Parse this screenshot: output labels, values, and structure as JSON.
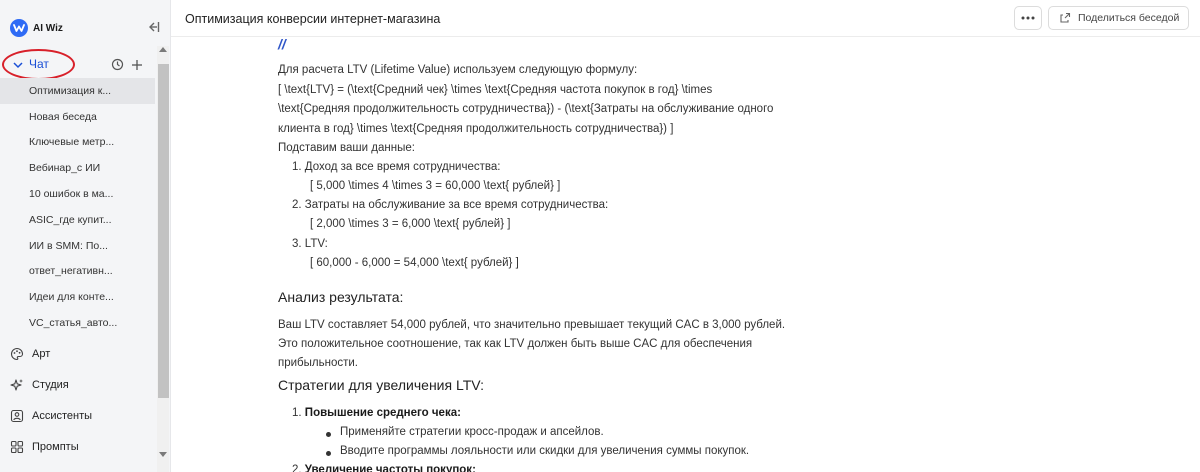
{
  "app": {
    "brand_name": "AI Wiz",
    "accent_color": "#2f6bf5",
    "highlight_color": "#d8202a"
  },
  "sidebar": {
    "collapse_icon": "collapse-sidebar-icon",
    "chat_section_label": "Чат",
    "chat_items": [
      "Оптимизация к...",
      "Новая беседа",
      "Ключевые метр...",
      "Вебинар_с ИИ",
      "10 ошибок в ма...",
      "ASIC_где купит...",
      "ИИ в SMM: По...",
      "ответ_негативн...",
      "Идеи для конте...",
      "VC_статья_авто..."
    ],
    "nav": [
      {
        "label": "Арт",
        "icon": "palette-icon"
      },
      {
        "label": "Студия",
        "icon": "sparkles-icon"
      },
      {
        "label": "Ассистенты",
        "icon": "assistant-icon"
      },
      {
        "label": "Промпты",
        "icon": "grid-icon"
      }
    ]
  },
  "header": {
    "title": "Оптимизация конверсии интернет-магазина",
    "share_label": "Поделиться беседой"
  },
  "message": {
    "slash": "//",
    "intro": "Для расчета LTV (Lifetime Value) используем следующую формулу:",
    "formula_line1": "[ \\text{LTV} = (\\text{Средний чек} \\times \\text{Средняя частота покупок в год} \\times",
    "formula_line2": "\\text{Средняя продолжительность сотрудничества}) - (\\text{Затраты на обслуживание одного",
    "formula_line3": "клиента в год} \\times \\text{Средняя продолжительность сотрудничества}) ]",
    "substitute": "Подставим ваши данные:",
    "steps": [
      {
        "num": "1.",
        "title": "Доход за все время сотрудничества:",
        "formula": "[ 5,000 \\times 4 \\times 3 = 60,000 \\text{ рублей} ]"
      },
      {
        "num": "2.",
        "title": "Затраты на обслуживание за все время сотрудничества:",
        "formula": "[ 2,000 \\times 3 = 6,000 \\text{ рублей} ]"
      },
      {
        "num": "3.",
        "title": "LTV:",
        "formula": "[ 60,000 - 6,000 = 54,000 \\text{ рублей} ]"
      }
    ],
    "analysis_heading": "Анализ результата:",
    "analysis_line1": "Ваш LTV составляет 54,000 рублей, что значительно превышает текущий CAC в 3,000 рублей.",
    "analysis_line2": "Это положительное соотношение, так как LTV должен быть выше CAC для обеспечения",
    "analysis_line3": "прибыльности.",
    "strategies_heading": "Стратегии для увеличения LTV:",
    "strategy1_num": "1.",
    "strategy1_title": "Повышение среднего чека:",
    "strategy1_bullets": [
      "Применяйте стратегии кросс-продаж и апсейлов.",
      "Вводите программы лояльности или скидки для увеличения суммы покупок."
    ],
    "strategy2_num": "2.",
    "strategy2_title": "Увеличение частоты покупок:"
  }
}
